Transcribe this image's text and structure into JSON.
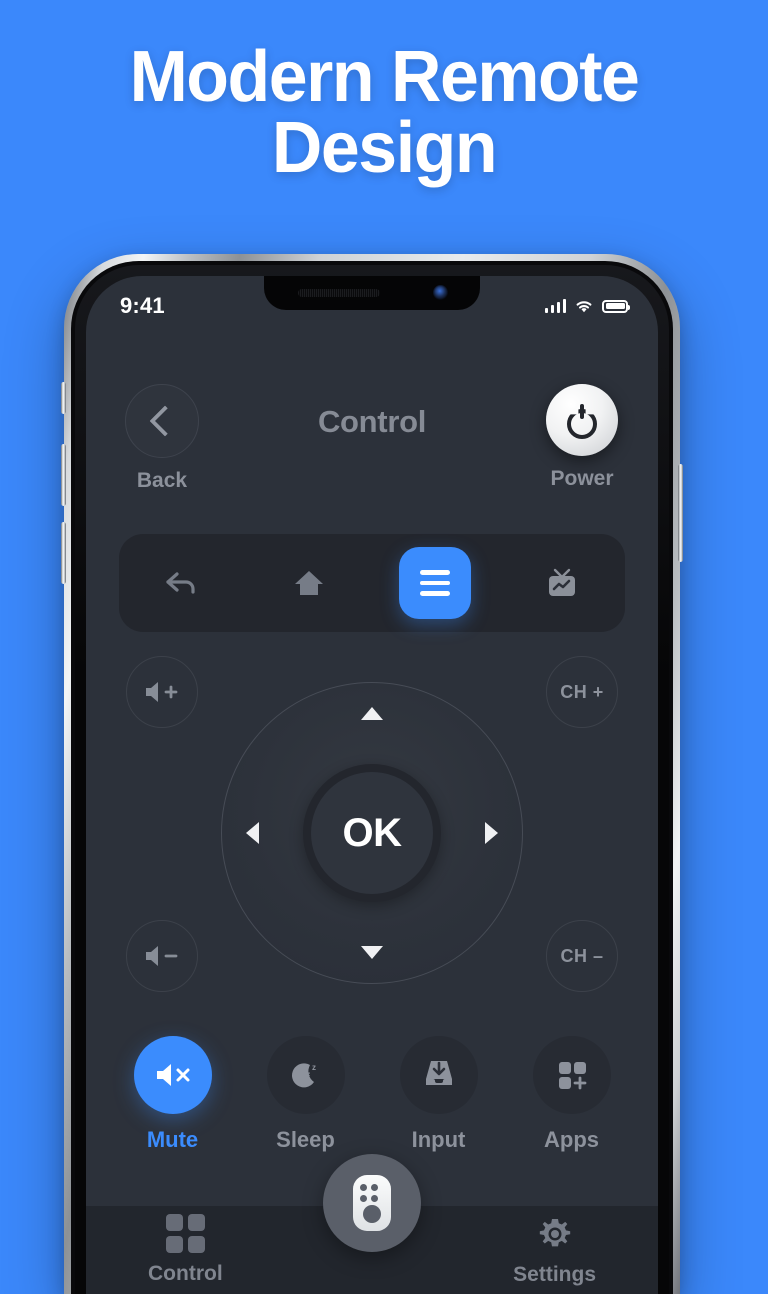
{
  "theme": {
    "background": "#3b88fb",
    "accent": "#3b8cfd",
    "screen_bg": "#2c313a",
    "panel_bg": "#23262d",
    "muted_text": "#8d929c"
  },
  "headline": {
    "line1": "Modern Remote",
    "line2": "Design"
  },
  "status_bar": {
    "time": "9:41",
    "signal_icon": "cellular-signal-icon",
    "wifi_icon": "wifi-icon",
    "battery_icon": "battery-full-icon"
  },
  "app_header": {
    "back": {
      "label": "Back",
      "icon": "chevron-left-icon"
    },
    "title": "Control",
    "power": {
      "label": "Power",
      "icon": "power-icon"
    }
  },
  "toolbar": {
    "items": [
      {
        "name": "back",
        "icon": "back-arrow-icon",
        "active": false
      },
      {
        "name": "home",
        "icon": "home-icon",
        "active": false
      },
      {
        "name": "menu",
        "icon": "menu-icon",
        "active": true
      },
      {
        "name": "guide",
        "icon": "tv-icon",
        "active": false
      }
    ]
  },
  "dpad": {
    "ok_label": "OK",
    "up_icon": "arrow-up-icon",
    "down_icon": "arrow-down-icon",
    "left_icon": "arrow-left-icon",
    "right_icon": "arrow-right-icon",
    "volume_up": {
      "label": "",
      "icon": "volume-up-icon"
    },
    "volume_down": {
      "label": "",
      "icon": "volume-down-icon"
    },
    "channel_up": {
      "label": "CH +",
      "icon": "channel-up-icon"
    },
    "channel_down": {
      "label": "CH –",
      "icon": "channel-down-icon"
    }
  },
  "functions": [
    {
      "label": "Mute",
      "icon": "mute-icon",
      "active": true
    },
    {
      "label": "Sleep",
      "icon": "sleep-moon-icon",
      "active": false
    },
    {
      "label": "Input",
      "icon": "input-tray-icon",
      "active": false
    },
    {
      "label": "Apps",
      "icon": "apps-grid-icon",
      "active": false
    }
  ],
  "bottom_nav": {
    "items": [
      {
        "label": "Control",
        "icon": "grid-icon",
        "active": false
      },
      {
        "label": "Settings",
        "icon": "gear-icon",
        "active": false
      }
    ],
    "fab": {
      "icon": "remote-icon"
    }
  }
}
